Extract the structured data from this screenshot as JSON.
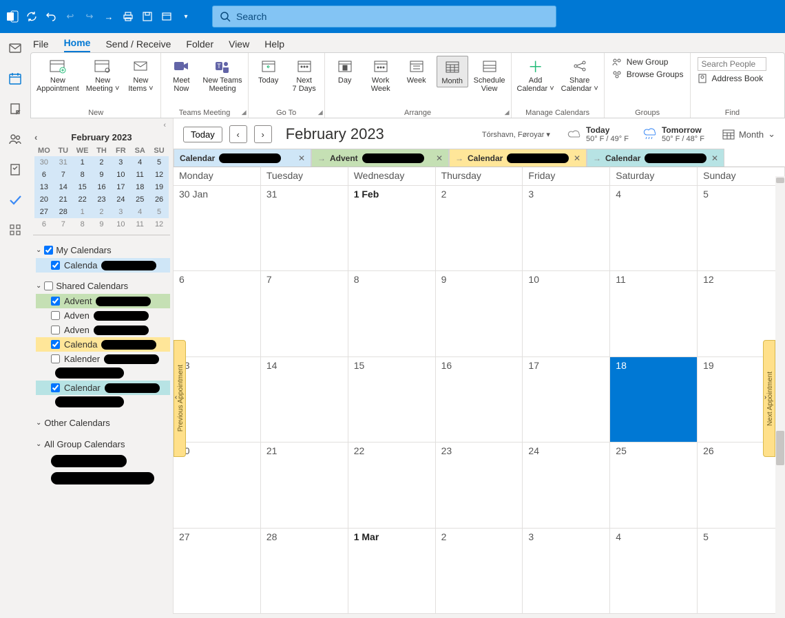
{
  "titlebar": {
    "search_placeholder": "Search"
  },
  "menu": {
    "file": "File",
    "home": "Home",
    "sendreceive": "Send / Receive",
    "folder": "Folder",
    "view": "View",
    "help": "Help"
  },
  "ribbon": {
    "new": {
      "label": "New",
      "appt": "New\nAppointment",
      "meeting": "New\nMeeting ˅",
      "items": "New\nItems ˅"
    },
    "teams": {
      "label": "Teams Meeting",
      "meetnow": "Meet\nNow",
      "newteams": "New Teams\nMeeting"
    },
    "goto": {
      "label": "Go To",
      "today": "Today",
      "next7": "Next\n7 Days"
    },
    "arrange": {
      "label": "Arrange",
      "day": "Day",
      "workweek": "Work\nWeek",
      "week": "Week",
      "month": "Month",
      "schedule": "Schedule\nView"
    },
    "manage": {
      "label": "Manage Calendars",
      "add": "Add\nCalendar ˅",
      "share": "Share\nCalendar ˅"
    },
    "groups": {
      "label": "Groups",
      "newgroup": "New Group",
      "browse": "Browse Groups"
    },
    "find": {
      "label": "Find",
      "search_placeholder": "Search People",
      "address": "Address Book"
    }
  },
  "minical": {
    "title": "February 2023",
    "dows": [
      "MO",
      "TU",
      "WE",
      "TH",
      "FR",
      "SA",
      "SU"
    ],
    "weeks": [
      [
        {
          "d": "30",
          "off": true,
          "r": true
        },
        {
          "d": "31",
          "off": true,
          "r": true
        },
        {
          "d": "1",
          "r": true
        },
        {
          "d": "2",
          "r": true
        },
        {
          "d": "3",
          "r": true
        },
        {
          "d": "4",
          "r": true
        },
        {
          "d": "5",
          "r": true
        }
      ],
      [
        {
          "d": "6",
          "r": true
        },
        {
          "d": "7",
          "r": true
        },
        {
          "d": "8",
          "r": true
        },
        {
          "d": "9",
          "r": true
        },
        {
          "d": "10",
          "r": true
        },
        {
          "d": "11",
          "r": true
        },
        {
          "d": "12",
          "r": true
        }
      ],
      [
        {
          "d": "13",
          "r": true
        },
        {
          "d": "14",
          "r": true
        },
        {
          "d": "15",
          "r": true
        },
        {
          "d": "16",
          "r": true
        },
        {
          "d": "17",
          "r": true
        },
        {
          "d": "18",
          "r": true
        },
        {
          "d": "19",
          "r": true
        }
      ],
      [
        {
          "d": "20",
          "r": true
        },
        {
          "d": "21",
          "r": true
        },
        {
          "d": "22",
          "r": true
        },
        {
          "d": "23",
          "r": true
        },
        {
          "d": "24",
          "r": true
        },
        {
          "d": "25",
          "r": true
        },
        {
          "d": "26",
          "r": true
        }
      ],
      [
        {
          "d": "27",
          "r": true
        },
        {
          "d": "28",
          "r": true
        },
        {
          "d": "1",
          "off": true,
          "r": true
        },
        {
          "d": "2",
          "off": true,
          "r": true
        },
        {
          "d": "3",
          "off": true,
          "r": true
        },
        {
          "d": "4",
          "off": true,
          "r": true
        },
        {
          "d": "5",
          "off": true,
          "r": true
        }
      ],
      [
        {
          "d": "6",
          "off": true
        },
        {
          "d": "7",
          "off": true
        },
        {
          "d": "8",
          "off": true
        },
        {
          "d": "9",
          "off": true
        },
        {
          "d": "10",
          "off": true
        },
        {
          "d": "11",
          "off": true
        },
        {
          "d": "12",
          "off": true
        }
      ]
    ]
  },
  "sidegroups": {
    "my": {
      "label": "My Calendars",
      "items": [
        {
          "label": "Calenda",
          "checked": true,
          "color": "#cfe6f7"
        }
      ]
    },
    "shared": {
      "label": "Shared Calendars",
      "items": [
        {
          "label": "Advent",
          "checked": true,
          "color": "#c5e0b4"
        },
        {
          "label": "Adven",
          "checked": false
        },
        {
          "label": "Adven",
          "checked": false
        },
        {
          "label": "Calenda",
          "checked": true,
          "color": "#ffe699"
        },
        {
          "label": "Kalender",
          "checked": false
        },
        {
          "label": "Calendar",
          "checked": true,
          "color": "#b7e3e4"
        }
      ]
    },
    "other": {
      "label": "Other Calendars"
    },
    "group": {
      "label": "All Group Calendars"
    }
  },
  "mainhead": {
    "today": "Today",
    "title": "February 2023",
    "location": "Tórshavn, Føroyar",
    "w1_label": "Today",
    "w1_temp": "50° F / 49° F",
    "w2_label": "Tomorrow",
    "w2_temp": "50° F / 48° F",
    "view": "Month"
  },
  "tabs": [
    {
      "label": "Calendar",
      "cls": "c1"
    },
    {
      "label": "Advent",
      "cls": "c2",
      "arrow": true
    },
    {
      "label": "Calendar",
      "cls": "c3",
      "arrow": true
    },
    {
      "label": "Calendar",
      "cls": "c4",
      "arrow": true
    }
  ],
  "dows": [
    "Monday",
    "Tuesday",
    "Wednesday",
    "Thursday",
    "Friday",
    "Saturday",
    "Sunday"
  ],
  "cells": [
    [
      {
        "t": "30 Jan"
      },
      {
        "t": "31"
      },
      {
        "t": "1 Feb",
        "b": true
      },
      {
        "t": "2"
      },
      {
        "t": "3"
      },
      {
        "t": "4"
      },
      {
        "t": "5"
      }
    ],
    [
      {
        "t": "6"
      },
      {
        "t": "7"
      },
      {
        "t": "8"
      },
      {
        "t": "9"
      },
      {
        "t": "10"
      },
      {
        "t": "11"
      },
      {
        "t": "12"
      }
    ],
    [
      {
        "t": "13"
      },
      {
        "t": "14"
      },
      {
        "t": "15"
      },
      {
        "t": "16"
      },
      {
        "t": "17"
      },
      {
        "t": "18",
        "today": true
      },
      {
        "t": "19"
      }
    ],
    [
      {
        "t": "20"
      },
      {
        "t": "21"
      },
      {
        "t": "22"
      },
      {
        "t": "23"
      },
      {
        "t": "24"
      },
      {
        "t": "25"
      },
      {
        "t": "26"
      }
    ],
    [
      {
        "t": "27"
      },
      {
        "t": "28"
      },
      {
        "t": "1 Mar",
        "b": true
      },
      {
        "t": "2"
      },
      {
        "t": "3"
      },
      {
        "t": "4"
      },
      {
        "t": "5"
      }
    ]
  ],
  "strips": {
    "prev": "Previous Appointment",
    "next": "Next Appointment"
  }
}
